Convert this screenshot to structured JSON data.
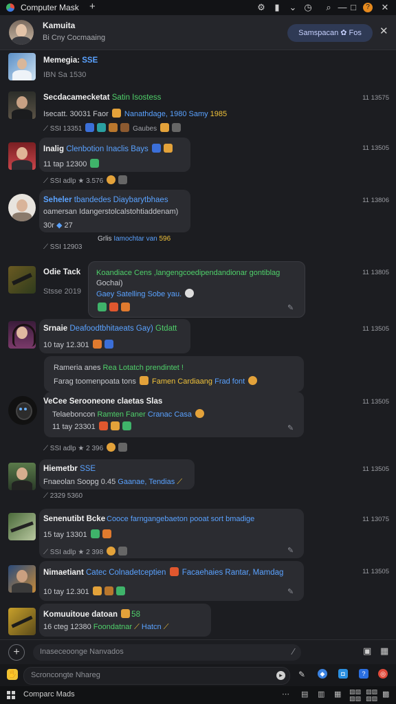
{
  "window": {
    "tab_title": "Computer Mask",
    "new_tab": "+"
  },
  "header": {
    "title": "Kamuita",
    "subtitle": "Bi Cny Cocmaaing",
    "pill_label": "Samspacan ✿ Fos"
  },
  "messages": [
    {
      "name": "Memegia: ",
      "name_tag": "SSE",
      "line1": "IBN Sa   1530",
      "time": ""
    },
    {
      "name": "Secdacamecketat",
      "name_tag": "Satin Isostess",
      "line1": "Isecatt. 30031   Faor",
      "line1b": "Nanathdage, 1980 Samy",
      "line1c": "1985",
      "meta": "SSI  13351",
      "reactions": "Gaubes",
      "time": "11 13575"
    },
    {
      "name": "Inalig",
      "name_tag": "Clenbotion Inaclis Bays",
      "line1": "11  tap   12300",
      "meta": "SSI   adlp",
      "reactions": "3.576",
      "time": "11 13505"
    },
    {
      "name": "Seheler",
      "name_tag": "tbandedes  Diaybarytbhaes",
      "line1": "oamersan Idangerstolcalstohtiaddenam)",
      "line1b": "30r",
      "line1c": "27",
      "meta": "SSI   12903",
      "footer": "Grlis",
      "footer_b": "Iamochtar van",
      "footer_c": "596",
      "time": "11 13806"
    },
    {
      "name": "Odie Tack",
      "line1": "Stsse  2019",
      "bubble1": "Koandiace Cens ,langengcoedipendandionar gontiblag",
      "bubble2": "Gochai)",
      "bubble3": "Gaey Satelling Sobe yau.",
      "time": "11 13805"
    },
    {
      "name": "Srnaie",
      "name_tag": "Deafoodtbhitaeats Gay)",
      "name_tag2": "Gtdatt",
      "line1": "10  tay   12.301",
      "time": "11 13505"
    },
    {
      "name": "",
      "bubble1": "Rameria anes",
      "bubble1b": "Rea Lotatch prendintet !",
      "bubble2": "Farag toomenpoata tons",
      "bubble2b": "Famen Cardiaang",
      "bubble2c": "Frad font",
      "time": ""
    },
    {
      "name": "VeCee Serooneone claetas Slas",
      "line1": "Telaeboncon",
      "line1b": "Ramten Faner",
      "line1c": "Cranac Casa",
      "line2": "11  tay   23301",
      "meta": "SSI   adlp",
      "reactions": "2 396",
      "time": "11 13505"
    },
    {
      "name": "Hiemetbr",
      "name_tag": "SSE",
      "line1": "Fnaeolan Soopg 0.45",
      "line1b": "Gaanae, Tendias",
      "meta": "2329  5360",
      "time": "11 13505"
    },
    {
      "name": "Senenutibt Bcke",
      "line1": "Cooce farngangebaeton pooat sort bmadige",
      "line2": "15 tay   13301",
      "meta": "SSI   adlp",
      "reactions": "2 398",
      "time": "11 13075"
    },
    {
      "name": "Nimaetiant",
      "name_tag": "Catec Colnadetceptien",
      "name_tag2": "Facaehaies Rantar, Mamdag",
      "line1": "10  tay   12.301",
      "time": "11 13505"
    },
    {
      "name": "Komuuitoue datoan",
      "name_tag": "58",
      "line1": "16  cteg   12380",
      "line1b": "Foondatnar",
      "line1c": "Hatcn",
      "time": ""
    }
  ],
  "composer": {
    "placeholder": "Inaseceoonge Nanvados",
    "placeholder2": "Scroncongte Nhareg"
  },
  "taskbar": {
    "label": "Comparc Mads"
  }
}
